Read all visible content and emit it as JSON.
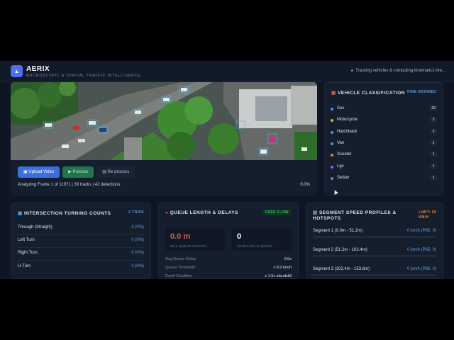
{
  "header": {
    "brand": "AERIX",
    "tagline": "MACROSCOPIC & SPATIAL TRAFFIC INTELLIGENCE",
    "status": "Tracking vehicles & computing kinematics live...",
    "logo_icon": "triangle-icon"
  },
  "video": {
    "upload_label": "Upload Video",
    "process_label": "Process",
    "reprocess_label": "Re-process",
    "frame_info": "Analyzing Frame 1 of 11971 | 39 tracks | 42 detections",
    "progress": "0.0%"
  },
  "vehicle_classification": {
    "title": "VEHICLE CLASSIFICATION",
    "badge": "FINE-GRAINED",
    "items": [
      {
        "name": "Suv",
        "count": "29",
        "color": "#4a90e2"
      },
      {
        "name": "Motorcycle",
        "count": "3",
        "color": "#e0b020"
      },
      {
        "name": "Hatchback",
        "count": "3",
        "color": "#5a8cf0"
      },
      {
        "name": "Van",
        "count": "1",
        "color": "#4a90e2"
      },
      {
        "name": "Scooter",
        "count": "1",
        "color": "#e08a20"
      },
      {
        "name": "Lgv",
        "count": "1",
        "color": "#a855f7"
      },
      {
        "name": "Sedan",
        "count": "1",
        "color": "#4a90e2"
      }
    ]
  },
  "turning_counts": {
    "title": "INTERSECTION TURNING COUNTS",
    "badge": "0 TRIPS",
    "rows": [
      {
        "label": "Through (Straight)",
        "value": "0 (0%)"
      },
      {
        "label": "Left Turn",
        "value": "0 (0%)"
      },
      {
        "label": "Right Turn",
        "value": "0 (0%)"
      },
      {
        "label": "U-Turn",
        "value": "0 (0%)"
      }
    ]
  },
  "queue": {
    "title": "QUEUE LENGTH & DELAYS",
    "badge": "FREE FLOW",
    "max_queue_value": "0.0 m",
    "max_queue_caption": "MAX QUEUE LENGTH",
    "vehicles_value": "0",
    "vehicles_caption": "VEHICLES IN QUEUE",
    "rows": [
      {
        "label": "Avg Queue Delay",
        "value": "0.0s"
      },
      {
        "label": "Queue Threshold",
        "value": "≤ 8.0 km/h"
      },
      {
        "label": "Dwell Condition",
        "value": "≥ 1.5s standstill"
      }
    ]
  },
  "speed": {
    "title_line1": "SEGMENT SPEED PROFILES &",
    "title_line2": "HOTSPOTS",
    "badge_line1": "LIMIT: 50",
    "badge_line2": "KM/H",
    "segments": [
      {
        "label": "Segment 1 (0.0m - 51.2m)",
        "value": "0 km/h (P85: 0)"
      },
      {
        "label": "Segment 2 (51.2m - 102.4m)",
        "value": "0 km/h (P85: 0)"
      },
      {
        "label": "Segment 3 (102.4m - 153.6m)",
        "value": "0 km/h (P85: 0)"
      }
    ]
  },
  "colors": {
    "accent": "#4f6ff0",
    "blue_value": "#5aa0e8",
    "green": "#22c55e",
    "orange": "#e08a30"
  }
}
